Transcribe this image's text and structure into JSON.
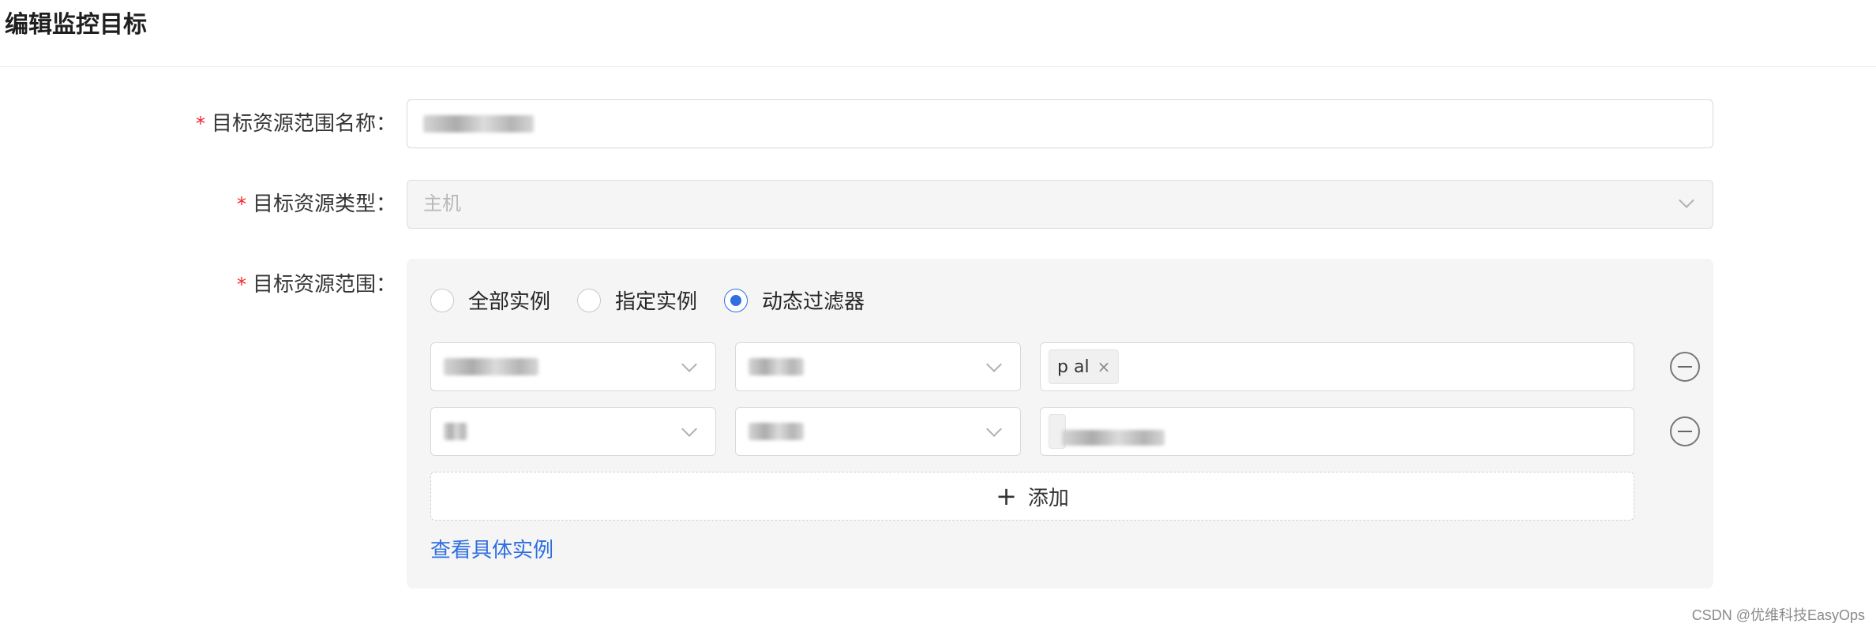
{
  "page": {
    "title": "编辑监控目标"
  },
  "form": {
    "name_field": {
      "label": "目标资源范围名称：",
      "value": "",
      "redacted": true
    },
    "type_field": {
      "label": "目标资源类型：",
      "value": "主机",
      "disabled": true
    },
    "scope_field": {
      "label": "目标资源范围：",
      "radios": [
        {
          "label": "全部实例",
          "checked": false
        },
        {
          "label": "指定实例",
          "checked": false
        },
        {
          "label": "动态过滤器",
          "checked": true
        }
      ],
      "conditions": [
        {
          "field": "",
          "operator": "",
          "value_tag": "p    al"
        },
        {
          "field": "",
          "operator": "",
          "value_tag": ""
        }
      ],
      "add_label": "添加",
      "view_link": "查看具体实例"
    },
    "required_mark": "*"
  },
  "watermark": "CSDN @优维科技EasyOps",
  "colors": {
    "accent": "#2f6fe0",
    "required": "#f5222d",
    "panel_bg": "#f5f5f5"
  },
  "icons": {
    "dropdown": "chevron-down-icon",
    "remove": "minus-circle-icon",
    "add": "plus-icon",
    "tag_close": "close-icon"
  }
}
